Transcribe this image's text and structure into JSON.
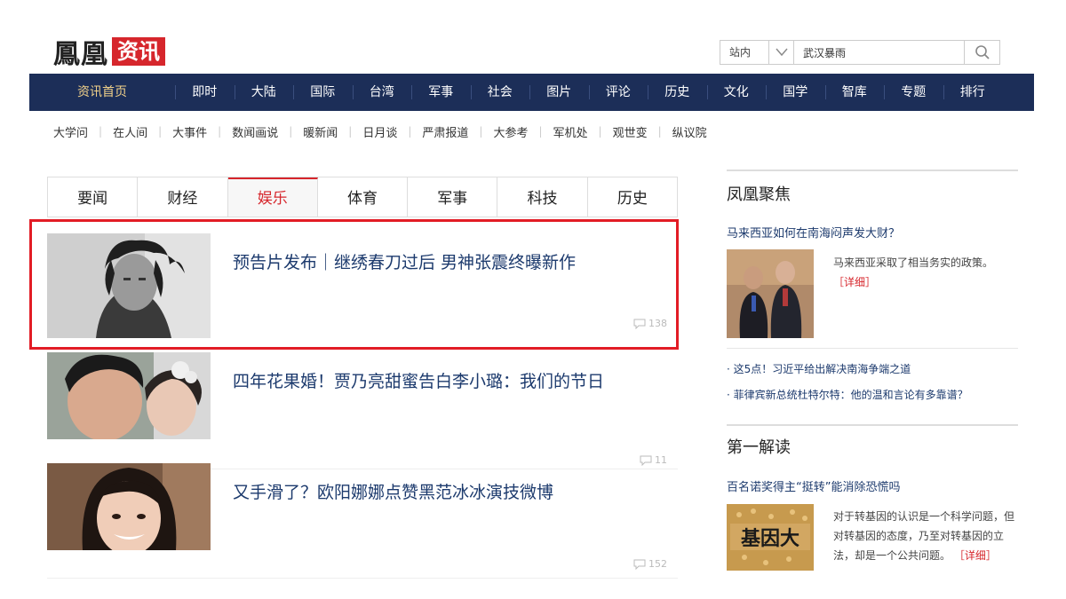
{
  "header": {
    "logo_main": "鳳凰",
    "logo_sub": "资讯",
    "search_scope": "站内",
    "search_value": "武汉暴雨"
  },
  "main_nav": [
    "资讯首页",
    "即时",
    "大陆",
    "国际",
    "台湾",
    "军事",
    "社会",
    "图片",
    "评论",
    "历史",
    "文化",
    "国学",
    "智库",
    "专题",
    "排行"
  ],
  "sub_nav": [
    "大学问",
    "在人间",
    "大事件",
    "数闻画说",
    "暖新闻",
    "日月谈",
    "严肃报道",
    "大参考",
    "军机处",
    "观世变",
    "纵议院"
  ],
  "tabs": [
    "要闻",
    "财经",
    "娱乐",
    "体育",
    "军事",
    "科技",
    "历史"
  ],
  "active_tab": "娱乐",
  "news": [
    {
      "title": "预告片发布｜继绣春刀过后 男神张震终曝新作",
      "comments": "138"
    },
    {
      "title": "四年花果婚！贾乃亮甜蜜告白李小璐：我们的节日",
      "comments": "11"
    },
    {
      "title": "又手滑了？欧阳娜娜点赞黑范冰冰演技微博",
      "comments": "152"
    }
  ],
  "right": {
    "focus_title": "凤凰聚焦",
    "focus_headline": "马来西亚如何在南海闷声发大财？",
    "focus_desc": "马来西亚采取了相当务实的政策。",
    "focus_more": "［详细］",
    "focus_links": [
      "这5点！习近平给出解决南海争端之道",
      "菲律宾新总统杜特尔特：他的温和言论有多靠谱？"
    ],
    "first_read_title": "第一解读",
    "first_read_headline": "百名诺奖得主“挺转”能消除恐慌吗",
    "first_read_desc": "对于转基因的认识是一个科学问题，但对转基因的态度，乃至对转基因的立法，却是一个公共问题。",
    "first_read_more": "［详细］",
    "first_read_img_text": "基因大"
  },
  "colors": {
    "nav_bg": "#1c2e58",
    "brand_red": "#d6262c",
    "link_blue": "#1c3a6d",
    "highlight_red": "#e21c25"
  }
}
